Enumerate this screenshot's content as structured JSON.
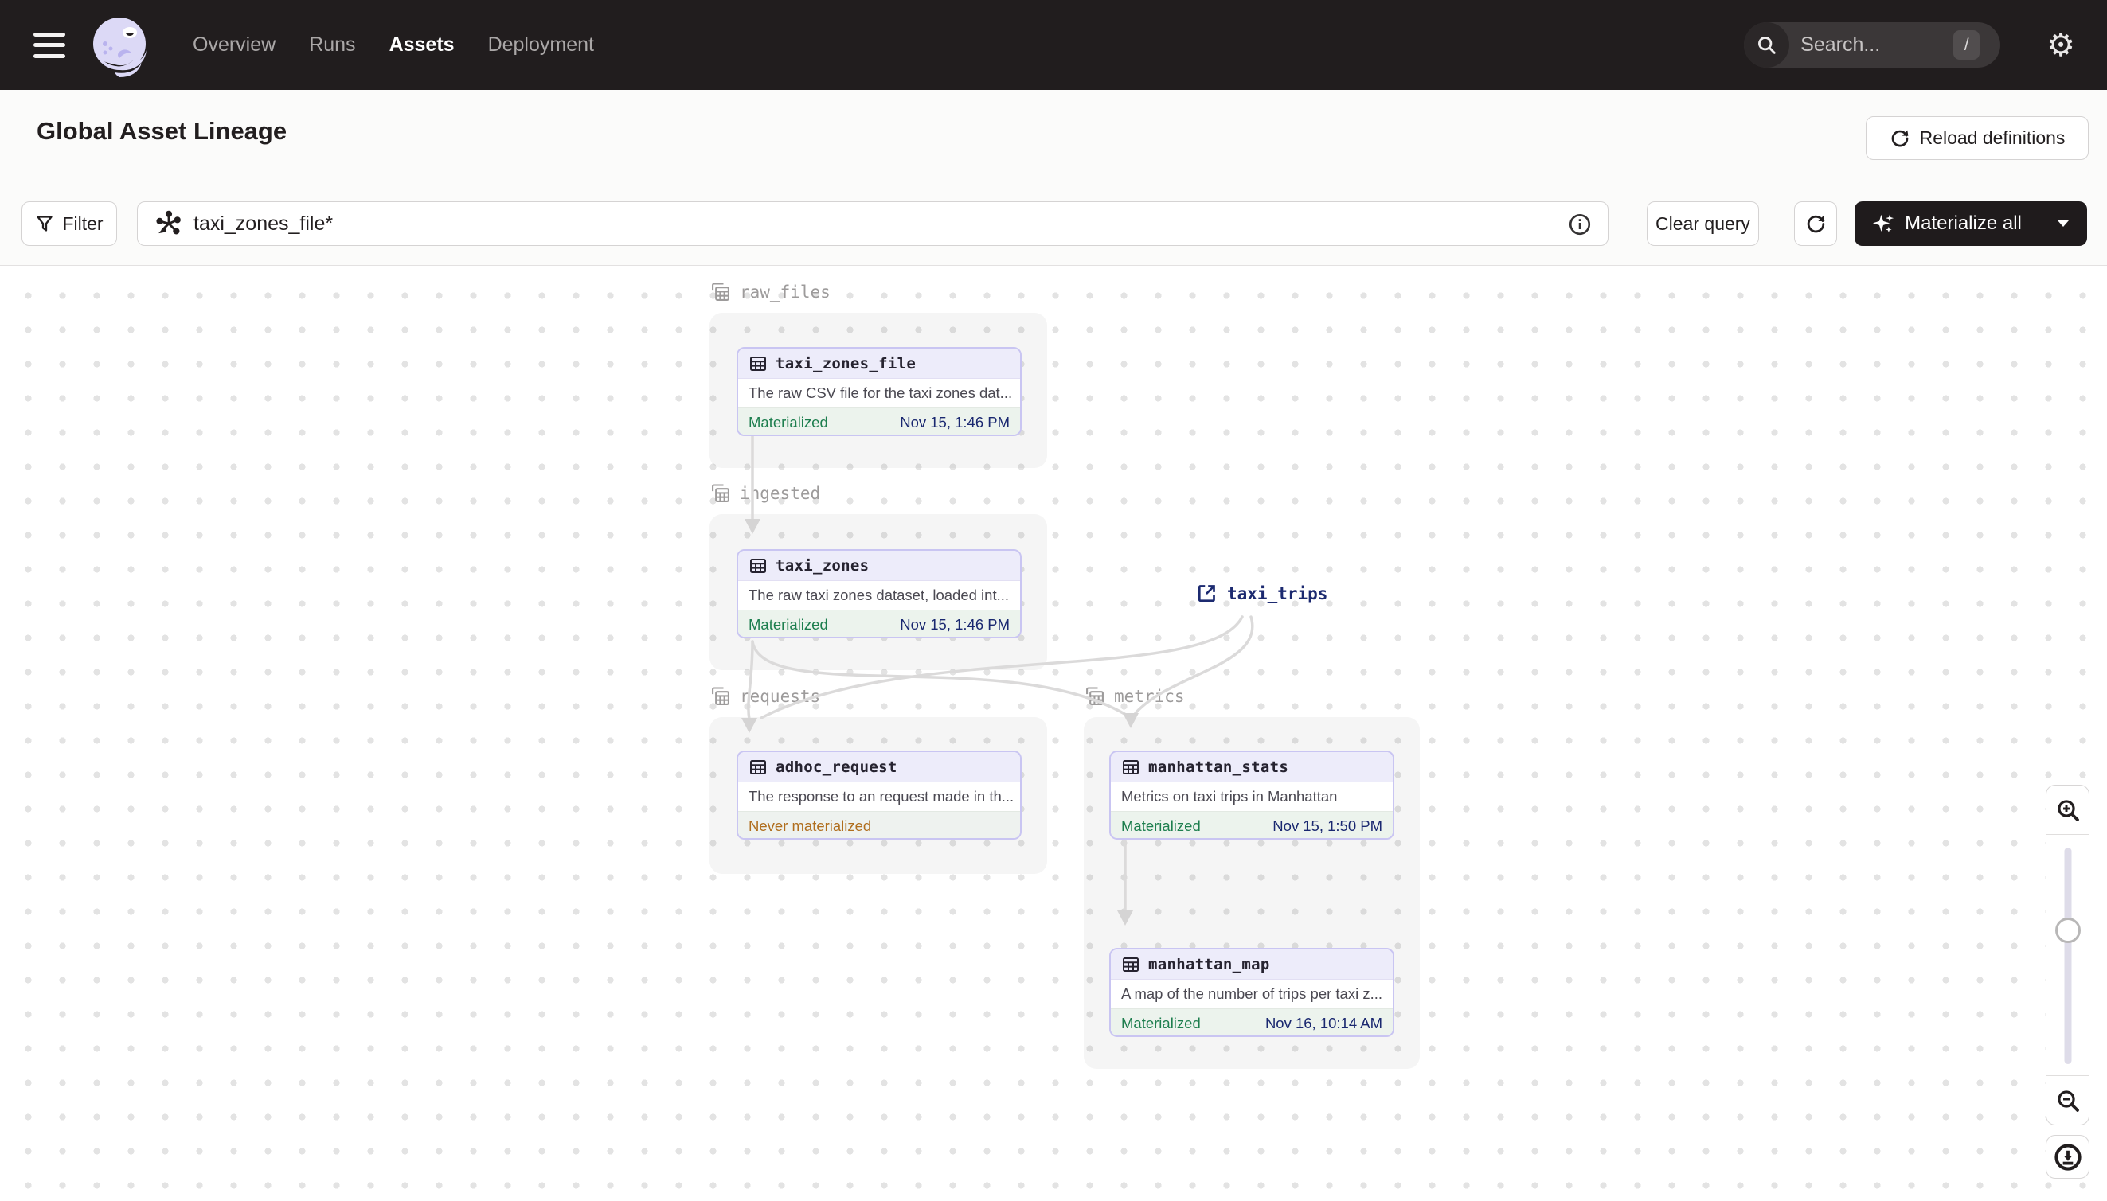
{
  "navbar": {
    "items": [
      {
        "label": "Overview",
        "active": false
      },
      {
        "label": "Runs",
        "active": false
      },
      {
        "label": "Assets",
        "active": true
      },
      {
        "label": "Deployment",
        "active": false
      }
    ],
    "search": {
      "placeholder": "Search...",
      "shortcut": "/"
    },
    "gear_glyph": "⚙"
  },
  "header": {
    "title": "Global Asset Lineage",
    "reload_label": "Reload definitions"
  },
  "toolbar": {
    "filter_label": "Filter",
    "query_value": "taxi_zones_file*",
    "clear_label": "Clear query",
    "materialize_label": "Materialize all"
  },
  "graph": {
    "groups": [
      {
        "name": "raw_files"
      },
      {
        "name": "ingested"
      },
      {
        "name": "requests"
      },
      {
        "name": "metrics"
      }
    ],
    "nodes": [
      {
        "name": "taxi_zones_file",
        "group": "raw_files",
        "description": "The raw CSV file for the taxi zones dat...",
        "status": "Materialized",
        "materialized_at": "Nov 15, 1:46 PM"
      },
      {
        "name": "taxi_zones",
        "group": "ingested",
        "description": "The raw taxi zones dataset, loaded int...",
        "status": "Materialized",
        "materialized_at": "Nov 15, 1:46 PM"
      },
      {
        "name": "adhoc_request",
        "group": "requests",
        "description": "The response to an request made in th...",
        "status": "Never materialized",
        "materialized_at": ""
      },
      {
        "name": "manhattan_stats",
        "group": "metrics",
        "description": "Metrics on taxi trips in Manhattan",
        "status": "Materialized",
        "materialized_at": "Nov 15, 1:50 PM"
      },
      {
        "name": "manhattan_map",
        "group": "metrics",
        "description": "A map of the number of trips per taxi z...",
        "status": "Materialized",
        "materialized_at": "Nov 16, 10:14 AM"
      }
    ],
    "external_assets": [
      {
        "name": "taxi_trips"
      }
    ],
    "edges": [
      {
        "from": "taxi_zones_file",
        "to": "taxi_zones"
      },
      {
        "from": "taxi_zones",
        "to": "adhoc_request"
      },
      {
        "from": "taxi_zones",
        "to": "manhattan_stats"
      },
      {
        "from": "taxi_trips",
        "to": "adhoc_request"
      },
      {
        "from": "taxi_trips",
        "to": "manhattan_stats"
      },
      {
        "from": "manhattan_stats",
        "to": "manhattan_map"
      }
    ]
  },
  "colors": {
    "navbar_bg": "#211d1e",
    "node_border": "#c9c5f2",
    "node_header_bg": "#edecfa",
    "materialized_green": "#1d7e4e",
    "never_materialized_orange": "#b06e1e",
    "timestamp_navy": "#1a2870",
    "external_asset_navy": "#1c2a70",
    "edge_gray": "#dbdada",
    "group_label_gray": "#9d9b9b",
    "canvas_dot": "#e3e3e3"
  }
}
